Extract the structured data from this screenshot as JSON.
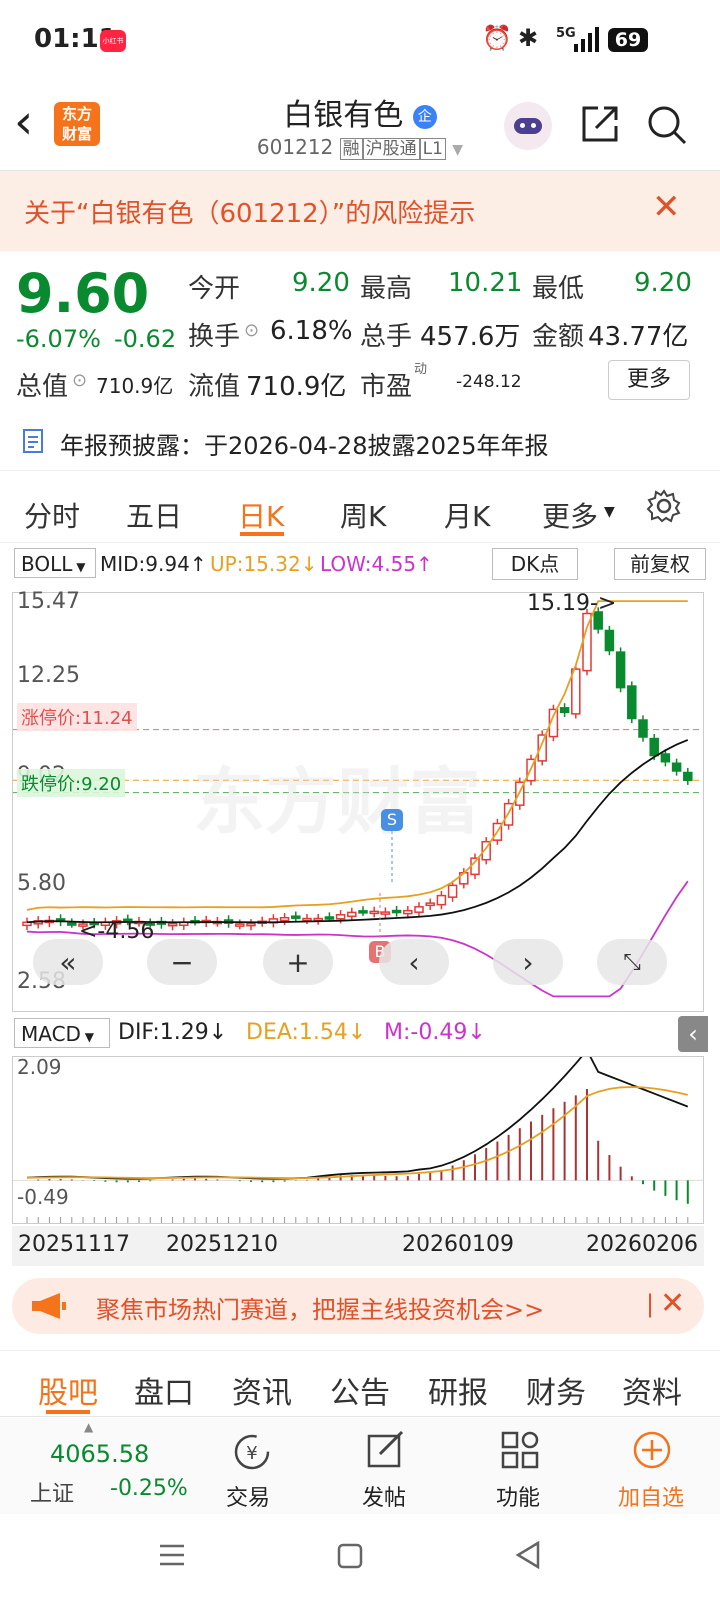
{
  "status_bar": {
    "time": "01:11",
    "app_badge": "小红书",
    "network": "5G",
    "battery": "69"
  },
  "header": {
    "title": "白银有色",
    "title_badge": "企",
    "code": "601212",
    "tags": [
      "融",
      "沪股通",
      "L1"
    ],
    "logo_line1": "东方",
    "logo_line2": "财富"
  },
  "risk_banner": {
    "text": "关于“白银有色（601212）”的风险提示"
  },
  "quote": {
    "price": "9.60",
    "change_pct": "-6.07%",
    "change_amt": "-0.62",
    "open_label": "今开",
    "open": "9.20",
    "high_label": "最高",
    "high": "10.21",
    "low_label": "最低",
    "low": "9.20",
    "turnover_label": "换手",
    "turnover": "6.18%",
    "volume_label": "总手",
    "volume": "457.6万",
    "amount_label": "金额",
    "amount": "43.77亿",
    "mcap_label": "总值",
    "mcap": "710.9亿",
    "float_label": "流值",
    "float": "710.9亿",
    "pe_label": "市盈",
    "pe_sup": "动",
    "pe": "-248.12",
    "more_button": "更多"
  },
  "notice": {
    "text": "年报预披露：于2026-04-28披露2025年年报"
  },
  "kline_tabs": [
    "分时",
    "五日",
    "日K",
    "周K",
    "月K",
    "更多"
  ],
  "active_tab": "日K",
  "boll": {
    "selector": "BOLL",
    "mid": "MID:9.94↑",
    "up": "UP:15.32↓",
    "low": "LOW:4.55↑",
    "dk_button": "DK点",
    "adjust_button": "前复权"
  },
  "kchart": {
    "y_labels": [
      "15.47",
      "12.25",
      "9.02",
      "5.80",
      "2.58"
    ],
    "limit_up": "涨停价:11.24",
    "limit_down": "跌停价:9.20",
    "max_marker": "15.19->",
    "min_marker": "<-4.56",
    "signal_s": "S",
    "signal_b": "B",
    "watermark": "东方财富"
  },
  "macd": {
    "selector": "MACD",
    "dif": "DIF:1.29↓",
    "dea": "DEA:1.54↓",
    "m": "M:-0.49↓",
    "y_max": "2.09",
    "y_min": "-0.49"
  },
  "x_labels": [
    "20251117",
    "20251210",
    "20260109",
    "20260206"
  ],
  "promo": {
    "text": "聚焦市场热门赛道，把握主线投资机会>>"
  },
  "bottom_tabs": [
    "股吧",
    "盘口",
    "资讯",
    "公告",
    "研报",
    "财务",
    "资料"
  ],
  "bottom_nav": {
    "index_value": "4065.58",
    "index_name": "上证",
    "index_change": "-0.25%",
    "items": [
      "交易",
      "发帖",
      "功能",
      "加自选"
    ]
  },
  "colors": {
    "up": "#e53935",
    "down": "#0a8a2e",
    "accent": "#f5731b",
    "boll_up": "#e8a020",
    "boll_low": "#cc33cc"
  }
}
